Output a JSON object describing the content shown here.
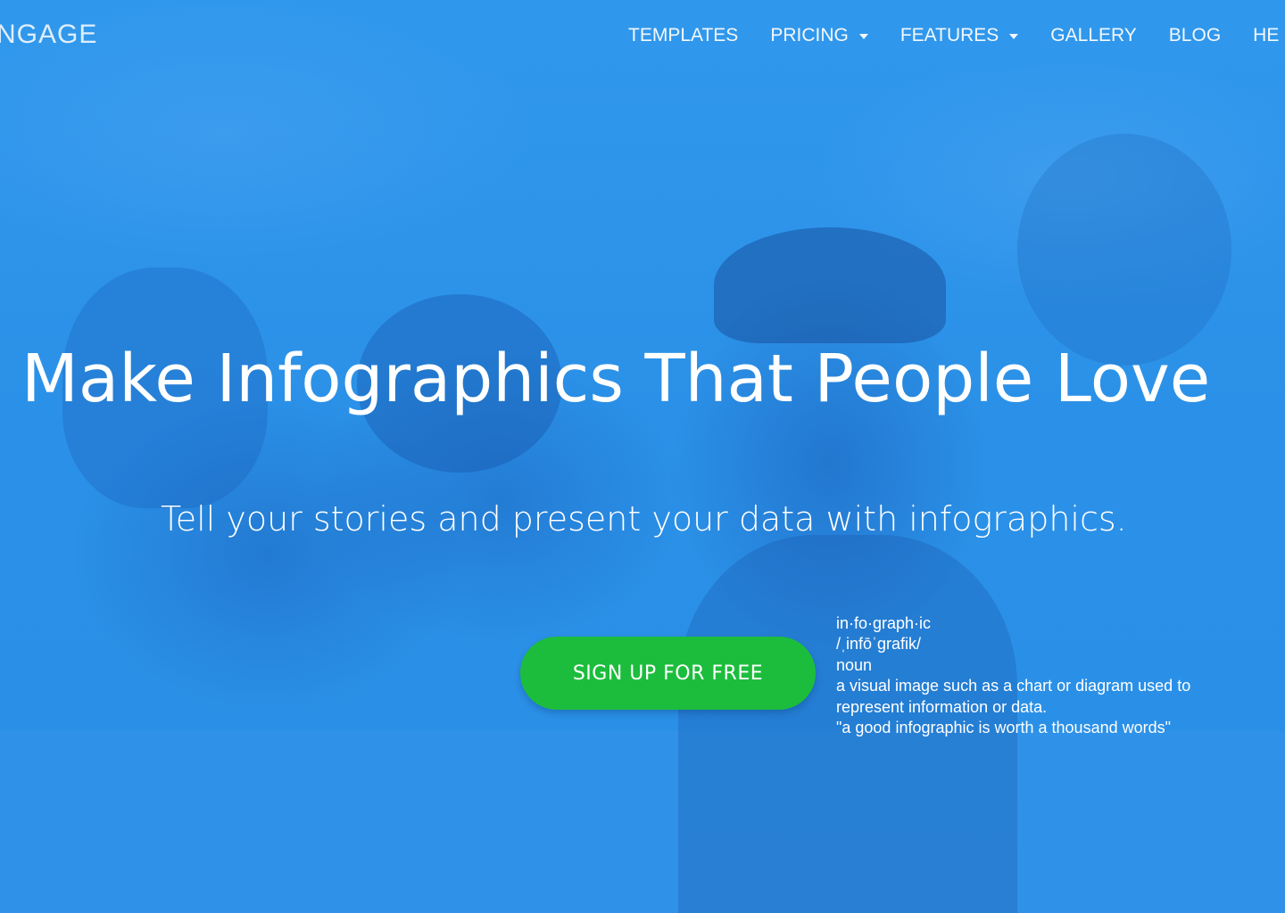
{
  "brand": {
    "logo_text": "NGAGE"
  },
  "nav": {
    "items": [
      {
        "label": "TEMPLATES",
        "has_dropdown": false
      },
      {
        "label": "PRICING",
        "has_dropdown": true
      },
      {
        "label": "FEATURES",
        "has_dropdown": true
      },
      {
        "label": "GALLERY",
        "has_dropdown": false
      },
      {
        "label": "BLOG",
        "has_dropdown": false
      },
      {
        "label": "HE",
        "has_dropdown": false
      }
    ]
  },
  "hero": {
    "headline": "Make Infographics That People Love",
    "subheadline": "Tell your stories and present your data with infographics.",
    "cta_label": "SIGN UP FOR FREE"
  },
  "definition": {
    "word": "in·fo·graph·ic",
    "pronunciation": "/ˌinfōˈgrafik/",
    "part_of_speech": "noun",
    "meaning_line1": "a visual image such as a chart or diagram used to",
    "meaning_line2": "represent information or data.",
    "example": "\"a good infographic is worth a thousand words\""
  },
  "colors": {
    "background": "#2c93ea",
    "cta": "#1cbd3c",
    "text": "#ffffff"
  }
}
